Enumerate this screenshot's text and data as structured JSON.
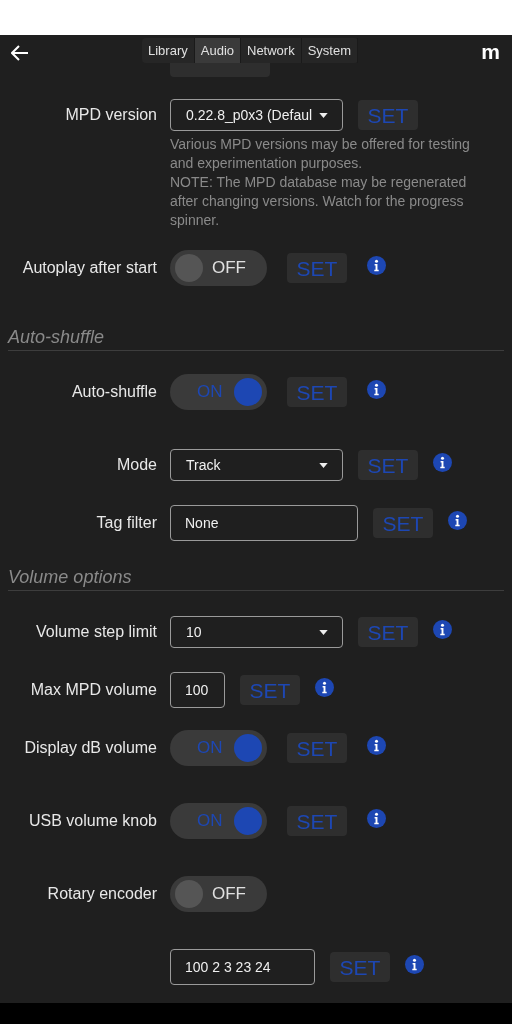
{
  "header": {
    "tabs": [
      {
        "label": "Library",
        "selected": false
      },
      {
        "label": "Audio",
        "selected": true
      },
      {
        "label": "Network",
        "selected": false
      },
      {
        "label": "System",
        "selected": false
      }
    ],
    "logo": "m"
  },
  "groups": [
    {
      "rows": [
        {
          "kind": "button"
        },
        {
          "kind": "select",
          "label": "MPD version",
          "value": "0.22.8_p0x3 (Defaul",
          "set": "SET",
          "info": false,
          "help": [
            "Various MPD versions may be offered for testing and experimentation purposes.",
            "NOTE: The MPD database may be regenerated after changing versions. Watch for the progress spinner."
          ]
        },
        {
          "kind": "toggle",
          "label": "Autoplay after start",
          "on": false,
          "state": "OFF",
          "set": "SET",
          "info": true
        }
      ]
    },
    {
      "heading": "Auto-shuffle",
      "rows": [
        {
          "kind": "toggle",
          "label": "Auto-shuffle",
          "on": true,
          "state": "ON",
          "set": "SET",
          "info": true
        },
        {
          "kind": "select",
          "label": "Mode",
          "value": "Track",
          "set": "SET",
          "info": true
        },
        {
          "kind": "text",
          "label": "Tag filter",
          "value": "None",
          "set": "SET",
          "info": true
        }
      ]
    },
    {
      "heading": "Volume options",
      "rows": [
        {
          "kind": "select",
          "label": "Volume step limit",
          "value": "10",
          "set": "SET",
          "info": true
        },
        {
          "kind": "number",
          "label": "Max MPD volume",
          "value": "100",
          "set": "SET",
          "info": true
        },
        {
          "kind": "toggle",
          "label": "Display dB volume",
          "on": true,
          "state": "ON",
          "set": "SET",
          "info": true
        },
        {
          "kind": "toggle",
          "label": "USB volume knob",
          "on": true,
          "state": "ON",
          "set": "SET",
          "info": true
        },
        {
          "kind": "toggle",
          "label": "Rotary encoder",
          "on": false,
          "state": "OFF",
          "info": false
        },
        {
          "kind": "list",
          "value": "100 2 3 23 24",
          "set": "SET",
          "info": true
        }
      ]
    }
  ]
}
